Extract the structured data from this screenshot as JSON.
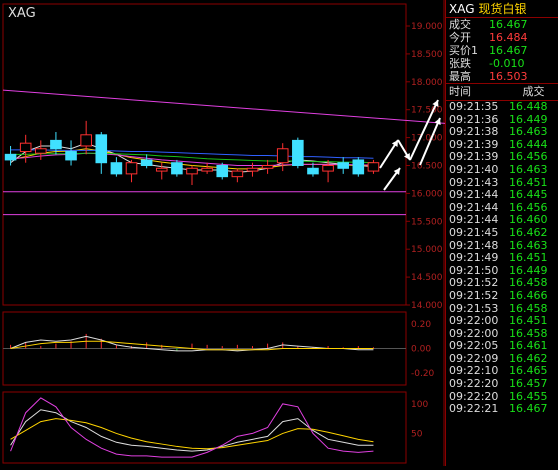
{
  "app": {
    "symbol": "XAG",
    "name": "现货白银"
  },
  "axis": {
    "main_ticks": [
      "19.000",
      "18.500",
      "18.000",
      "17.500",
      "17.000",
      "16.500",
      "16.000",
      "15.500",
      "15.000",
      "14.500",
      "14.000"
    ],
    "macd_ticks": [
      "0.20",
      "0.00",
      "-0.20"
    ],
    "kdj_ticks": [
      "100",
      "50"
    ]
  },
  "quote": {
    "rows": [
      {
        "label": "成交",
        "value": "16.467",
        "color": "#18e018"
      },
      {
        "label": "今开",
        "value": "16.484",
        "color": "#ff3b3b"
      },
      {
        "label": "买价1",
        "value": "16.467",
        "color": "#18e018"
      },
      {
        "label": "张跌",
        "value": "-0.010",
        "color": "#18e018"
      },
      {
        "label": "最高",
        "value": "16.503",
        "color": "#ff3b3b"
      }
    ],
    "col_time": "时间",
    "col_price": "成交"
  },
  "ticks": [
    {
      "time": "09:21:35",
      "price": "16.448"
    },
    {
      "time": "09:21:36",
      "price": "16.449"
    },
    {
      "time": "09:21:38",
      "price": "16.463"
    },
    {
      "time": "09:21:39",
      "price": "16.444"
    },
    {
      "time": "09:21:39",
      "price": "16.456"
    },
    {
      "time": "09:21:40",
      "price": "16.463"
    },
    {
      "time": "09:21:43",
      "price": "16.451"
    },
    {
      "time": "09:21:44",
      "price": "16.445"
    },
    {
      "time": "09:21:44",
      "price": "16.456"
    },
    {
      "time": "09:21:44",
      "price": "16.460"
    },
    {
      "time": "09:21:45",
      "price": "16.462"
    },
    {
      "time": "09:21:48",
      "price": "16.463"
    },
    {
      "time": "09:21:49",
      "price": "16.451"
    },
    {
      "time": "09:21:50",
      "price": "16.449"
    },
    {
      "time": "09:21:52",
      "price": "16.458"
    },
    {
      "time": "09:21:52",
      "price": "16.466"
    },
    {
      "time": "09:21:53",
      "price": "16.458"
    },
    {
      "time": "09:22:00",
      "price": "16.451"
    },
    {
      "time": "09:22:00",
      "price": "16.458"
    },
    {
      "time": "09:22:05",
      "price": "16.461"
    },
    {
      "time": "09:22:09",
      "price": "16.462"
    },
    {
      "time": "09:22:10",
      "price": "16.465"
    },
    {
      "time": "09:22:20",
      "price": "16.457"
    },
    {
      "time": "09:22:20",
      "price": "16.455"
    },
    {
      "time": "09:22:21",
      "price": "16.467"
    }
  ],
  "chart_data": {
    "type": "candlestick",
    "ylim": [
      14.0,
      19.0
    ],
    "candles": [
      {
        "o": 16.7,
        "h": 16.85,
        "l": 16.5,
        "c": 16.6
      },
      {
        "o": 16.75,
        "h": 17.05,
        "l": 16.55,
        "c": 16.9
      },
      {
        "o": 16.72,
        "h": 16.95,
        "l": 16.6,
        "c": 16.8
      },
      {
        "o": 16.95,
        "h": 17.1,
        "l": 16.7,
        "c": 16.8
      },
      {
        "o": 16.75,
        "h": 16.95,
        "l": 16.5,
        "c": 16.6
      },
      {
        "o": 16.85,
        "h": 17.3,
        "l": 16.7,
        "c": 17.05
      },
      {
        "o": 17.05,
        "h": 17.1,
        "l": 16.35,
        "c": 16.55
      },
      {
        "o": 16.55,
        "h": 16.65,
        "l": 16.3,
        "c": 16.35
      },
      {
        "o": 16.35,
        "h": 16.6,
        "l": 16.2,
        "c": 16.55
      },
      {
        "o": 16.6,
        "h": 16.7,
        "l": 16.45,
        "c": 16.5
      },
      {
        "o": 16.4,
        "h": 16.55,
        "l": 16.25,
        "c": 16.45
      },
      {
        "o": 16.55,
        "h": 16.6,
        "l": 16.3,
        "c": 16.35
      },
      {
        "o": 16.35,
        "h": 16.5,
        "l": 16.15,
        "c": 16.45
      },
      {
        "o": 16.4,
        "h": 16.55,
        "l": 16.35,
        "c": 16.45
      },
      {
        "o": 16.5,
        "h": 16.55,
        "l": 16.25,
        "c": 16.3
      },
      {
        "o": 16.3,
        "h": 16.45,
        "l": 16.2,
        "c": 16.4
      },
      {
        "o": 16.4,
        "h": 16.55,
        "l": 16.3,
        "c": 16.45
      },
      {
        "o": 16.45,
        "h": 16.6,
        "l": 16.35,
        "c": 16.5
      },
      {
        "o": 16.55,
        "h": 16.9,
        "l": 16.4,
        "c": 16.8
      },
      {
        "o": 16.95,
        "h": 17.0,
        "l": 16.45,
        "c": 16.5
      },
      {
        "o": 16.45,
        "h": 16.55,
        "l": 16.3,
        "c": 16.35
      },
      {
        "o": 16.4,
        "h": 16.6,
        "l": 16.2,
        "c": 16.5
      },
      {
        "o": 16.55,
        "h": 16.65,
        "l": 16.35,
        "c": 16.45
      },
      {
        "o": 16.6,
        "h": 16.65,
        "l": 16.3,
        "c": 16.35
      },
      {
        "o": 16.4,
        "h": 16.6,
        "l": 16.35,
        "c": 16.55
      }
    ],
    "lines": [
      {
        "color": "#dddddd",
        "values": [
          16.55,
          16.75,
          16.85,
          16.85,
          16.8,
          16.9,
          16.8,
          16.7,
          16.55,
          16.52,
          16.48,
          16.45,
          16.42,
          16.42,
          16.42,
          16.38,
          16.4,
          16.45,
          16.55,
          16.6,
          16.58,
          16.55,
          16.52,
          16.5,
          16.48
        ]
      },
      {
        "color": "#ffd400",
        "values": [
          16.6,
          16.66,
          16.72,
          16.75,
          16.76,
          16.8,
          16.76,
          16.7,
          16.64,
          16.6,
          16.56,
          16.53,
          16.5,
          16.48,
          16.46,
          16.44,
          16.44,
          16.46,
          16.5,
          16.52,
          16.52,
          16.52,
          16.51,
          16.5,
          16.5
        ]
      },
      {
        "color": "#e040e0",
        "values": [
          16.62,
          16.64,
          16.67,
          16.69,
          16.7,
          16.72,
          16.71,
          16.69,
          16.66,
          16.63,
          16.6,
          16.58,
          16.56,
          16.54,
          16.52,
          16.5,
          16.5,
          16.5,
          16.51,
          16.52,
          16.52,
          16.52,
          16.52,
          16.51,
          16.51
        ]
      },
      {
        "color": "#18c018",
        "values": [
          16.7,
          16.7,
          16.71,
          16.71,
          16.71,
          16.72,
          16.72,
          16.71,
          16.7,
          16.69,
          16.67,
          16.66,
          16.64,
          16.62,
          16.61,
          16.6,
          16.59,
          16.58,
          16.58,
          16.58,
          16.57,
          16.57,
          16.56,
          16.56,
          16.55
        ]
      },
      {
        "color": "#3060ff",
        "values": [
          16.78,
          16.78,
          16.78,
          16.77,
          16.77,
          16.77,
          16.77,
          16.76,
          16.75,
          16.75,
          16.74,
          16.73,
          16.72,
          16.71,
          16.7,
          16.69,
          16.68,
          16.68,
          16.67,
          16.66,
          16.66,
          16.65,
          16.64,
          16.64,
          16.63
        ]
      }
    ],
    "trendline": {
      "color": "#e040e0",
      "from": [
        0,
        17.85
      ],
      "to": [
        29,
        17.25
      ]
    },
    "hlines": [
      {
        "value": 16.03,
        "color": "#e040e0"
      },
      {
        "value": 15.62,
        "color": "#e040e0"
      }
    ],
    "macd": {
      "hist": [
        0.03,
        0.05,
        0.02,
        0.04,
        0.06,
        0.12,
        0.08,
        0.03,
        0.02,
        0.05,
        0.03,
        -0.02,
        0.04,
        0.03,
        0.02,
        0.03,
        0.02,
        0.04,
        0.05,
        0.02,
        0.01,
        0.02,
        0.01,
        0.02,
        0.01
      ],
      "dif": [
        0.0,
        0.05,
        0.07,
        0.06,
        0.07,
        0.1,
        0.07,
        0.03,
        0.01,
        0.0,
        -0.01,
        -0.02,
        -0.02,
        -0.01,
        -0.01,
        -0.02,
        -0.01,
        0.0,
        0.03,
        0.02,
        0.01,
        0.0,
        0.0,
        -0.01,
        -0.01
      ],
      "dea": [
        0.0,
        0.02,
        0.04,
        0.05,
        0.05,
        0.06,
        0.06,
        0.05,
        0.04,
        0.03,
        0.02,
        0.01,
        0.0,
        -0.01,
        -0.01,
        -0.01,
        -0.01,
        -0.01,
        0.0,
        0.0,
        0.0,
        0.0,
        0.0,
        0.0,
        0.0
      ],
      "ylim": [
        -0.3,
        0.3
      ]
    },
    "kdj": {
      "k": [
        30,
        70,
        90,
        85,
        70,
        60,
        45,
        35,
        30,
        28,
        25,
        22,
        20,
        22,
        28,
        35,
        40,
        45,
        70,
        75,
        55,
        40,
        35,
        30,
        30
      ],
      "d": [
        40,
        55,
        70,
        75,
        72,
        68,
        60,
        50,
        42,
        36,
        32,
        28,
        25,
        24,
        26,
        30,
        34,
        38,
        50,
        58,
        57,
        52,
        46,
        40,
        36
      ],
      "j": [
        20,
        85,
        110,
        95,
        60,
        40,
        25,
        15,
        12,
        12,
        10,
        10,
        10,
        18,
        30,
        45,
        50,
        60,
        100,
        95,
        50,
        25,
        20,
        18,
        20
      ],
      "ylim": [
        0,
        120
      ]
    }
  }
}
